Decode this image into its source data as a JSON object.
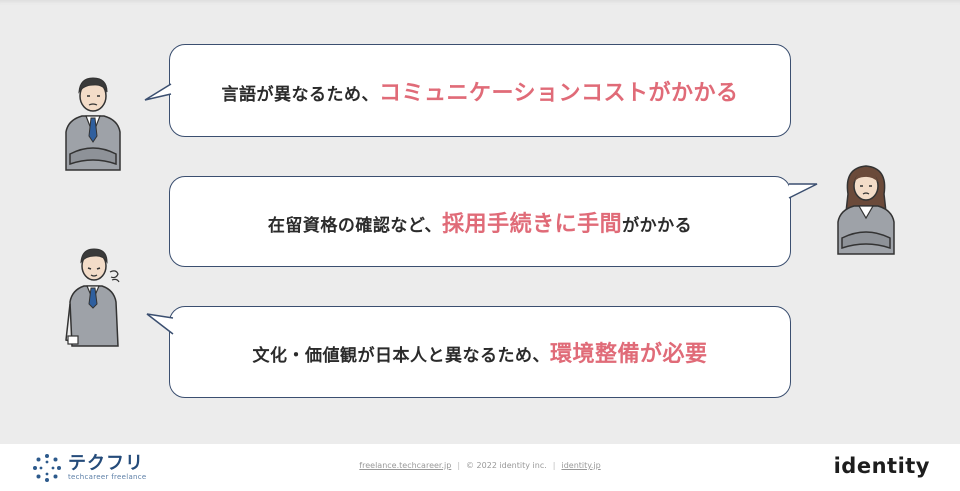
{
  "bubbles": [
    {
      "plain": "言語が異なるため、",
      "highlight": "コミュニケーションコストがかかる",
      "suffix": ""
    },
    {
      "plain": "在留資格の確認など、",
      "highlight": "採用手続きに手間",
      "suffix": "がかかる"
    },
    {
      "plain": "文化・価値観が日本人と異なるため、",
      "highlight": "環境整備が必要",
      "suffix": ""
    }
  ],
  "footer": {
    "brand_name": "テクフリ",
    "brand_sub": "techcareer freelance",
    "link1": "freelance.techcareer.jp",
    "separator": "|",
    "copyright": "© 2022 identity inc.",
    "link2": "identity.jp",
    "right_logo": "identity"
  },
  "colors": {
    "highlight": "#e06b78",
    "bubble_border": "#3b4f70",
    "brand": "#244b7a"
  },
  "icons": [
    "man-crossed-arms-icon",
    "woman-crossed-arms-icon",
    "man-sighing-icon",
    "techfuri-logo-icon"
  ]
}
